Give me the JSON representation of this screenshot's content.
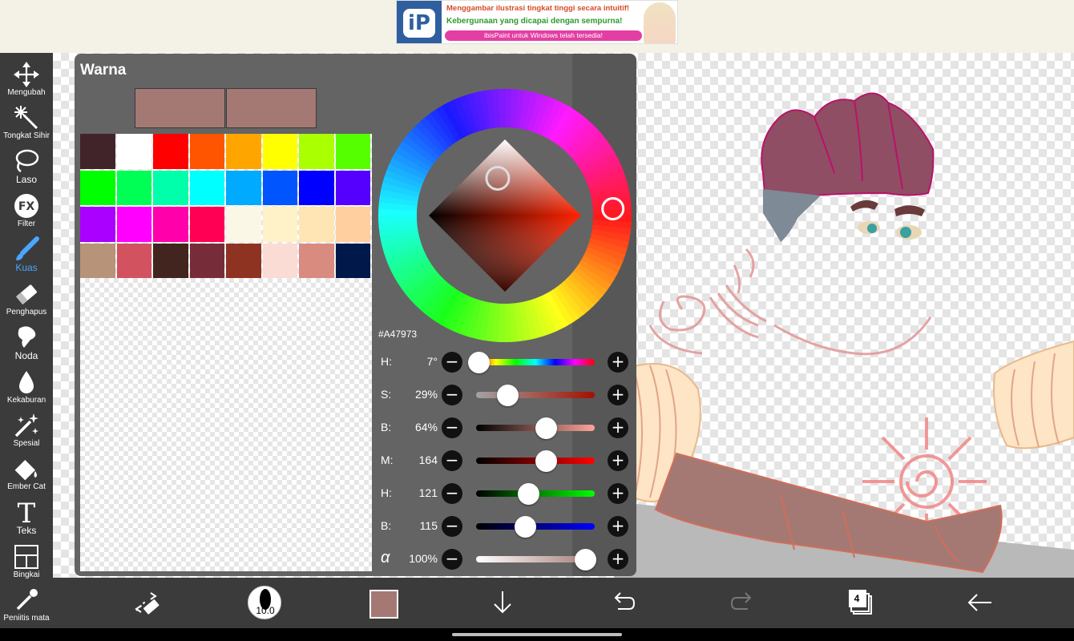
{
  "ad": {
    "logo_text": "iP",
    "line1": "Menggambar ilustrasi tingkat tinggi secara intuitif!",
    "line2": "Kebergunaan yang dicapai dengan sempurna!",
    "line3": "ibisPaint untuk Windows telah tersedia!"
  },
  "tools": [
    {
      "label": "Mengubah",
      "icon": "move-arrows-icon"
    },
    {
      "label": "Tongkat Sihir",
      "icon": "magic-wand-icon"
    },
    {
      "label": "Laso",
      "icon": "lasso-icon"
    },
    {
      "label": "Filter",
      "icon": "fx-icon"
    },
    {
      "label": "Kuas",
      "icon": "brush-icon"
    },
    {
      "label": "Penghapus",
      "icon": "eraser-icon"
    },
    {
      "label": "Noda",
      "icon": "smudge-icon"
    },
    {
      "label": "Kekaburan",
      "icon": "blur-drop-icon"
    },
    {
      "label": "Spesial",
      "icon": "special-wand-icon"
    },
    {
      "label": "Ember Cat",
      "icon": "paint-bucket-icon"
    },
    {
      "label": "Teks",
      "icon": "text-icon"
    },
    {
      "label": "Bingkai",
      "icon": "frame-icon"
    },
    {
      "label": "Peniitis mata",
      "icon": "eyedropper-icon"
    }
  ],
  "active_tool": "Kuas",
  "panel": {
    "title": "Warna",
    "previous_color": "#A47973",
    "current_color": "#A47973",
    "hex": "#A47973",
    "palette": [
      "#41242a",
      "#ffffff",
      "#ff0000",
      "#ff5500",
      "#ffa500",
      "#ffff00",
      "#aaff00",
      "#55ff00",
      "#00ff00",
      "#00ff55",
      "#00ffaa",
      "#00ffff",
      "#00aaff",
      "#0055ff",
      "#0000ff",
      "#5500ff",
      "#aa00ff",
      "#ff00ff",
      "#ff00aa",
      "#ff0055",
      "#faf7e6",
      "#fff1c8",
      "#ffe4b4",
      "#ffcfa0",
      "#b69379",
      "#d3525f",
      "#43251f",
      "#772d39",
      "#8e3322",
      "#fadcd4",
      "#d98b80",
      "#00184a"
    ],
    "sliders": [
      {
        "label": "H:",
        "value": "7°",
        "fraction": 0.02
      },
      {
        "label": "S:",
        "value": "29%",
        "fraction": 0.29
      },
      {
        "label": "B:",
        "value": "64%",
        "fraction": 0.64
      },
      {
        "label": "M:",
        "value": "164",
        "fraction": 0.643
      },
      {
        "label": "H:",
        "value": "121",
        "fraction": 0.475
      },
      {
        "label": "B:",
        "value": "115",
        "fraction": 0.451
      },
      {
        "label": "α",
        "value": "100%",
        "fraction": 1.0
      }
    ],
    "minus_label": "−",
    "plus_label": "+"
  },
  "bottom": {
    "brush_size": "10.0",
    "current_color": "#A47973",
    "layer_count": "4"
  }
}
